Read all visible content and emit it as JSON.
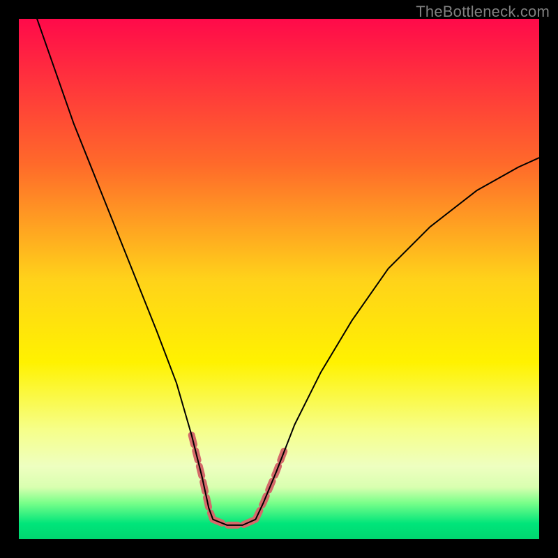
{
  "watermark": "TheBottleneck.com",
  "chart_data": {
    "type": "line",
    "title": "",
    "xlabel": "",
    "ylabel": "",
    "xlim": [
      0,
      100
    ],
    "ylim": [
      0,
      100
    ],
    "grid": false,
    "legend": false,
    "gradient_stops": [
      {
        "offset": 0,
        "color": "#ff0a4a"
      },
      {
        "offset": 28,
        "color": "#ff6a2a"
      },
      {
        "offset": 50,
        "color": "#ffd21a"
      },
      {
        "offset": 66,
        "color": "#fff200"
      },
      {
        "offset": 79,
        "color": "#f6ff8a"
      },
      {
        "offset": 86,
        "color": "#eeffc0"
      },
      {
        "offset": 90,
        "color": "#d9ffb0"
      },
      {
        "offset": 93,
        "color": "#7aff8a"
      },
      {
        "offset": 97,
        "color": "#00e57a"
      },
      {
        "offset": 100,
        "color": "#00d770"
      }
    ],
    "series": [
      {
        "name": "left-arm",
        "stroke": "#000000",
        "stroke_width": 2,
        "points": [
          {
            "x": 3.5,
            "y": 100
          },
          {
            "x": 7.0,
            "y": 90
          },
          {
            "x": 10.5,
            "y": 80
          },
          {
            "x": 14.5,
            "y": 70
          },
          {
            "x": 18.5,
            "y": 60
          },
          {
            "x": 22.5,
            "y": 50
          },
          {
            "x": 26.5,
            "y": 40
          },
          {
            "x": 30.3,
            "y": 30
          },
          {
            "x": 33.2,
            "y": 20
          },
          {
            "x": 35.2,
            "y": 12
          },
          {
            "x": 36.5,
            "y": 6
          },
          {
            "x": 37.3,
            "y": 3.8
          }
        ]
      },
      {
        "name": "valley-floor",
        "stroke": "#000000",
        "stroke_width": 2,
        "points": [
          {
            "x": 37.3,
            "y": 3.8
          },
          {
            "x": 40.0,
            "y": 2.7
          },
          {
            "x": 43.0,
            "y": 2.7
          },
          {
            "x": 45.5,
            "y": 3.8
          }
        ]
      },
      {
        "name": "right-arm",
        "stroke": "#000000",
        "stroke_width": 2,
        "points": [
          {
            "x": 45.5,
            "y": 3.8
          },
          {
            "x": 47.0,
            "y": 7
          },
          {
            "x": 49.5,
            "y": 13
          },
          {
            "x": 53.0,
            "y": 22
          },
          {
            "x": 58.0,
            "y": 32
          },
          {
            "x": 64.0,
            "y": 42
          },
          {
            "x": 71.0,
            "y": 52
          },
          {
            "x": 79.0,
            "y": 60
          },
          {
            "x": 88.0,
            "y": 67
          },
          {
            "x": 96.0,
            "y": 71.5
          },
          {
            "x": 100,
            "y": 73.3
          }
        ]
      },
      {
        "name": "highlight-segments",
        "stroke": "#d46a6a",
        "stroke_width": 10,
        "segments": [
          [
            {
              "x": 33.2,
              "y": 20
            },
            {
              "x": 35.2,
              "y": 12
            },
            {
              "x": 36.5,
              "y": 6
            },
            {
              "x": 37.3,
              "y": 3.8
            }
          ],
          [
            {
              "x": 37.3,
              "y": 3.8
            },
            {
              "x": 40.0,
              "y": 2.7
            },
            {
              "x": 43.0,
              "y": 2.7
            },
            {
              "x": 45.5,
              "y": 3.8
            }
          ],
          [
            {
              "x": 45.5,
              "y": 3.8
            },
            {
              "x": 47.0,
              "y": 7
            },
            {
              "x": 49.5,
              "y": 13
            },
            {
              "x": 51.0,
              "y": 17
            }
          ]
        ]
      }
    ]
  }
}
